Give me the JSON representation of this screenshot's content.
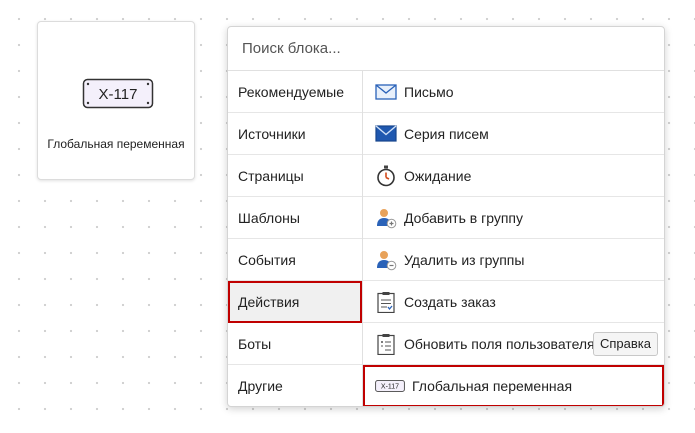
{
  "node": {
    "label": "Глобальная переменная",
    "icon_text": "X-117"
  },
  "search": {
    "placeholder": "Поиск блока..."
  },
  "categories": [
    {
      "label": "Рекомендуемые"
    },
    {
      "label": "Источники"
    },
    {
      "label": "Страницы"
    },
    {
      "label": "Шаблоны"
    },
    {
      "label": "События"
    },
    {
      "label": "Действия",
      "selected": true
    },
    {
      "label": "Боты"
    },
    {
      "label": "Другие"
    }
  ],
  "items": [
    {
      "label": "Письмо",
      "icon": "envelope-icon"
    },
    {
      "label": "Серия писем",
      "icon": "envelope-series-icon"
    },
    {
      "label": "Ожидание",
      "icon": "stopwatch-icon"
    },
    {
      "label": "Добавить в группу",
      "icon": "add-user-icon"
    },
    {
      "label": "Удалить из группы",
      "icon": "remove-user-icon"
    },
    {
      "label": "Создать заказ",
      "icon": "clipboard-order-icon"
    },
    {
      "label": "Обновить поля пользователя",
      "icon": "clipboard-fields-icon",
      "button": "Справка"
    },
    {
      "label": "Глобальная переменная",
      "icon": "variable-plate-icon",
      "icon_text": "X-117",
      "highlighted": true
    }
  ],
  "colors": {
    "highlight": "#c00000",
    "accent": "#2a62b8"
  }
}
